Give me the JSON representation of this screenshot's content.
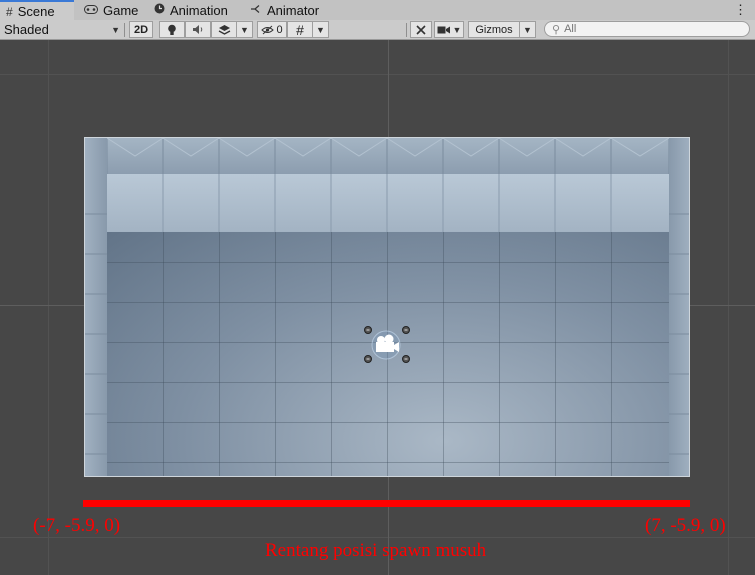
{
  "tabs": [
    {
      "label": "Scene",
      "icon": "grid-hash-icon"
    },
    {
      "label": "Game",
      "icon": "gamepad-icon"
    },
    {
      "label": "Animation",
      "icon": "animation-clock-icon"
    },
    {
      "label": "Animator",
      "icon": "animator-branch-icon"
    }
  ],
  "tab_menu": "⋮",
  "toolbar": {
    "shading_mode": "Shaded",
    "mode_2d": "2D",
    "hidden_count": "0",
    "gizmos": "Gizmos",
    "search_placeholder": "All"
  },
  "annotations": {
    "left_coord": "(-7, -5.9, 0)",
    "right_coord": "(7, -5.9, 0)",
    "caption": "Rentang posisi spawn musuh"
  },
  "colors": {
    "annotation": "#ff0000",
    "active_tab_accent": "#3a79d6",
    "viewport_bg": "#474747"
  }
}
